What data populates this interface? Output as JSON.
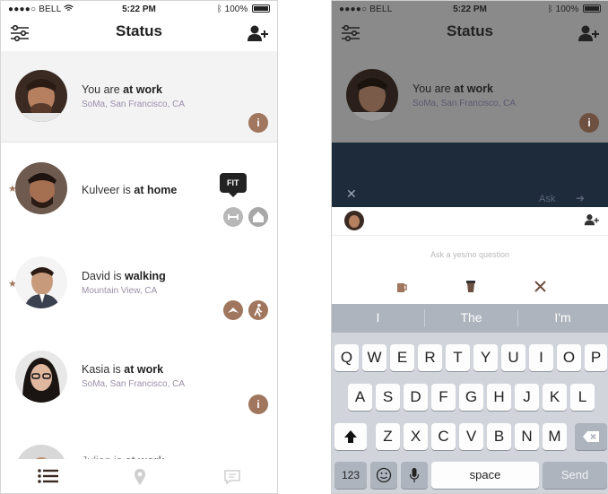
{
  "status_bar": {
    "carrier": "BELL",
    "time": "5:22 PM",
    "battery": "100%"
  },
  "nav": {
    "title": "Status"
  },
  "people": [
    {
      "name": "You",
      "verb": "are",
      "status": "at work",
      "location": "SoMa, San Francisco, CA",
      "starred": false
    },
    {
      "name": "Kulveer",
      "verb": "is",
      "status": "at home",
      "location": "",
      "starred": true
    },
    {
      "name": "David",
      "verb": "is",
      "status": "walking",
      "location": "Mountain View, CA",
      "starred": true
    },
    {
      "name": "Kasia",
      "verb": "is",
      "status": "at work",
      "location": "SoMa, San Francisco, CA",
      "starred": false
    },
    {
      "name": "Julian",
      "verb": "is",
      "status": "at work",
      "location": "",
      "starred": false
    }
  ],
  "tooltip": {
    "label": "FIT"
  },
  "icons": {
    "info": "i",
    "accent": "#a0765e",
    "grey": "#a8a8a8"
  },
  "compose": {
    "ask_label": "Ask",
    "placeholder": "Ask a yes/no question"
  },
  "keyboard": {
    "suggestions": [
      "I",
      "The",
      "I'm"
    ],
    "row1": [
      "Q",
      "W",
      "E",
      "R",
      "T",
      "Y",
      "U",
      "I",
      "O",
      "P"
    ],
    "row2": [
      "A",
      "S",
      "D",
      "F",
      "G",
      "H",
      "J",
      "K",
      "L"
    ],
    "row3": [
      "Z",
      "X",
      "C",
      "V",
      "B",
      "N",
      "M"
    ],
    "numbers_label": "123",
    "space_label": "space",
    "send_label": "Send"
  }
}
